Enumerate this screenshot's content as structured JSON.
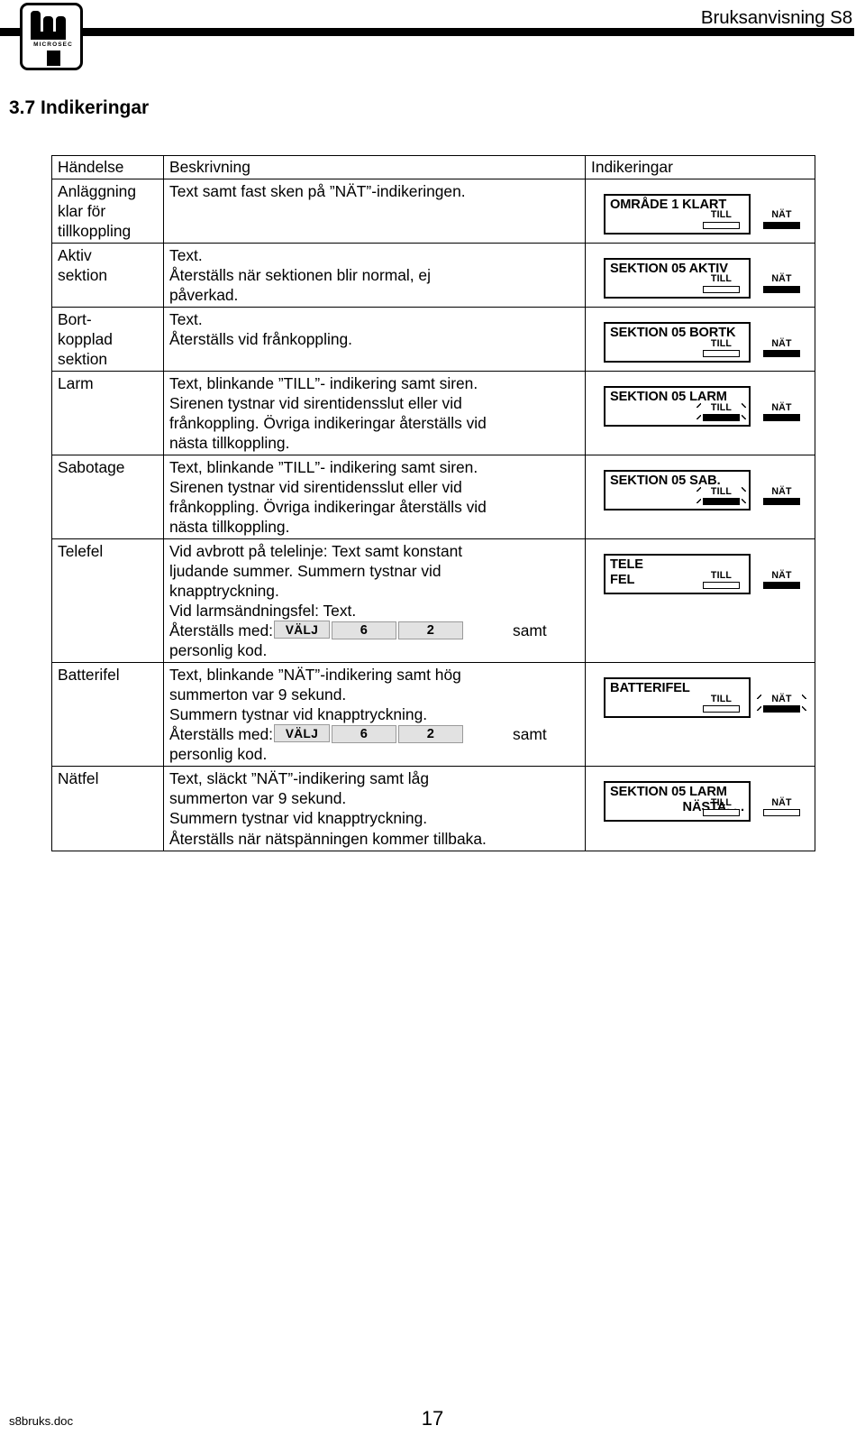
{
  "header": {
    "manual_title": "Bruksanvisning S8",
    "logo_wordmark": "MICROSEC"
  },
  "section": {
    "heading": "3.7 Indikeringar"
  },
  "table": {
    "columns": [
      "Händelse",
      "Beskrivning",
      "Indikeringar"
    ],
    "rows": [
      {
        "event": "Anläggning\nklar för\ntillkoppling",
        "description": "Text samt fast sken på ”NÄT”-indikeringen.",
        "display_lines": [
          "OMRÅDE 1 KLART"
        ],
        "display_align": [
          "left"
        ],
        "leds": [
          {
            "label": "TILL",
            "state": "off",
            "blink": false
          },
          {
            "label": "NÄT",
            "state": "on",
            "blink": false
          }
        ]
      },
      {
        "event": "Aktiv\nsektion",
        "description": "Text.\nÅterställs när sektionen blir normal, ej\npåverkad.",
        "display_lines": [
          "SEKTION 05 AKTIV"
        ],
        "display_align": [
          "left"
        ],
        "leds": [
          {
            "label": "TILL",
            "state": "off",
            "blink": false
          },
          {
            "label": "NÄT",
            "state": "on",
            "blink": false
          }
        ]
      },
      {
        "event": "Bort-\nkopplad\nsektion",
        "description": "Text.\nÅterställs vid frånkoppling.",
        "display_lines": [
          "SEKTION 05 BORTK"
        ],
        "display_align": [
          "left"
        ],
        "leds": [
          {
            "label": "TILL",
            "state": "off",
            "blink": false
          },
          {
            "label": "NÄT",
            "state": "on",
            "blink": false
          }
        ]
      },
      {
        "event": "Larm",
        "description": "Text, blinkande ”TILL”- indikering samt siren.\nSirenen tystnar vid sirentidensslut eller vid\nfrånkoppling. Övriga indikeringar återställs vid\nnästa tillkoppling.",
        "display_lines": [
          "SEKTION 05 LARM"
        ],
        "display_align": [
          "left"
        ],
        "leds": [
          {
            "label": "TILL",
            "state": "on",
            "blink": true
          },
          {
            "label": "NÄT",
            "state": "on",
            "blink": false
          }
        ]
      },
      {
        "event": "Sabotage",
        "description": "Text, blinkande ”TILL”- indikering samt siren.\nSirenen tystnar vid sirentidensslut eller vid\nfrånkoppling. Övriga indikeringar återställs vid\nnästa tillkoppling.",
        "display_lines": [
          "SEKTION 05 SAB."
        ],
        "display_align": [
          "left"
        ],
        "leds": [
          {
            "label": "TILL",
            "state": "on",
            "blink": true
          },
          {
            "label": "NÄT",
            "state": "on",
            "blink": false
          }
        ]
      },
      {
        "event": "Telefel",
        "description_before": "Vid avbrott på telelinje: Text samt konstant\nljudande summer. Summern tystnar vid\nknapptryckning.\nVid larmsändningsfel: Text.\nÅterställs med:",
        "description_after": "personlig kod.",
        "keys": [
          "VÄLJ",
          "6",
          "2"
        ],
        "key_suffix": "samt",
        "display_lines": [
          "TELE",
          "FEL"
        ],
        "display_align": [
          "left",
          "left"
        ],
        "leds": [
          {
            "label": "TILL",
            "state": "off",
            "blink": false
          },
          {
            "label": "NÄT",
            "state": "on",
            "blink": false
          }
        ]
      },
      {
        "event": "Batterifel",
        "description_before": "Text, blinkande ”NÄT”-indikering samt hög\nsummerton var 9 sekund.\nSummern tystnar vid knapptryckning.\nÅterställs med:",
        "description_after": "personlig kod.",
        "keys": [
          "VÄLJ",
          "6",
          "2"
        ],
        "key_suffix": "samt",
        "display_lines": [
          "BATTERIFEL"
        ],
        "display_align": [
          "left"
        ],
        "leds": [
          {
            "label": "TILL",
            "state": "off",
            "blink": false
          },
          {
            "label": "NÄT",
            "state": "on",
            "blink": true
          }
        ]
      },
      {
        "event": "Nätfel",
        "description": "Text, släckt ”NÄT”-indikering samt låg\nsummerton var 9 sekund.\nSummern tystnar vid knapptryckning.\nÅterställs när nätspänningen kommer tillbaka.",
        "display_lines": [
          "SEKTION 05 LARM",
          "NÄSTA. . ."
        ],
        "display_align": [
          "left",
          "right"
        ],
        "leds": [
          {
            "label": "TILL",
            "state": "off",
            "blink": false
          },
          {
            "label": "NÄT",
            "state": "off",
            "blink": false
          }
        ]
      }
    ]
  },
  "footer": {
    "doc_name": "s8bruks.doc",
    "page_number": "17"
  }
}
